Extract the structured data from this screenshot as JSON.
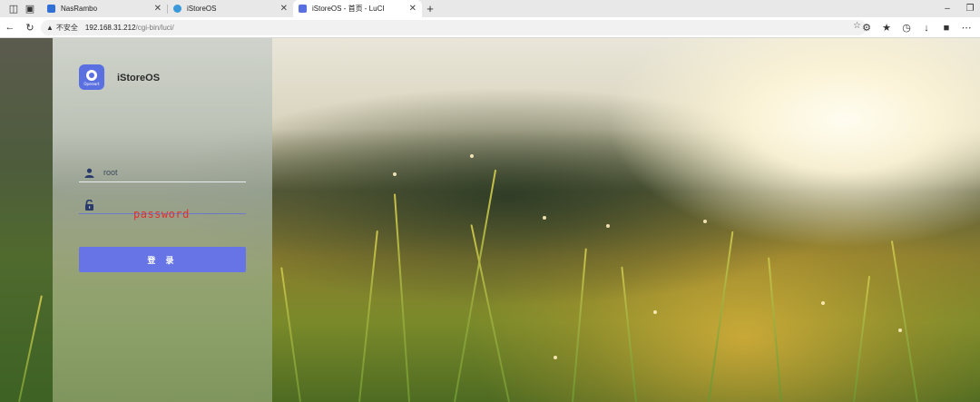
{
  "browser": {
    "tabs": [
      {
        "title": "NasRambo",
        "favicon_color": "#2f6fd6",
        "active": false
      },
      {
        "title": "iStoreOS",
        "favicon_color": "#3a9ad9",
        "active": false
      },
      {
        "title": "iStoreOS - 首页 - LuCI",
        "favicon_color": "#5a6fe0",
        "active": true
      }
    ],
    "new_tab_icon": "+",
    "address": {
      "security_label": "不安全",
      "host": "192.168.31.212",
      "path": "/cgi-bin/luci/"
    }
  },
  "login": {
    "brand": "iStoreOS",
    "logo_text": "Openwrt",
    "username_value": "root",
    "password_hint": "password",
    "submit_label": "登 录"
  },
  "colors": {
    "accent": "#6674e6",
    "password_hint": "#e03030",
    "logo_bg": "#5a6fe0"
  }
}
